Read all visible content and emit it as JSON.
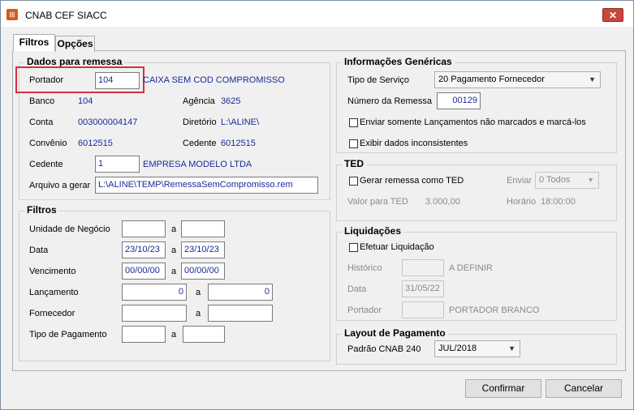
{
  "window": {
    "title": "CNAB CEF SIACC",
    "app_icon_glyph": "⊞",
    "close_glyph": "✕"
  },
  "tabs": [
    {
      "label": "Filtros",
      "active": true
    },
    {
      "label": "Opções",
      "active": false
    }
  ],
  "dados": {
    "legend": "Dados para remessa",
    "portador": {
      "label": "Portador",
      "value": "104",
      "desc": "CAIXA SEM COD COMPROMISSO"
    },
    "banco": {
      "label": "Banco",
      "value": "104"
    },
    "agencia": {
      "label": "Agência",
      "value": "3625"
    },
    "conta": {
      "label": "Conta",
      "value": "003000004147"
    },
    "diretorio": {
      "label": "Diretório",
      "value": "L:\\ALINE\\"
    },
    "convenio": {
      "label": "Convênio",
      "value": "6012515"
    },
    "cedente_code": {
      "label": "Cedente",
      "value": "6012515"
    },
    "cedente": {
      "label": "Cedente",
      "value": "1",
      "desc": "EMPRESA MODELO LTDA"
    },
    "arquivo": {
      "label": "Arquivo a gerar",
      "value": "L:\\ALINE\\TEMP\\RemessaSemCompromisso.rem"
    }
  },
  "filtros": {
    "legend": "Filtros",
    "sep": "a",
    "unidade": {
      "label": "Unidade de Negócio",
      "from": "",
      "to": ""
    },
    "data": {
      "label": "Data",
      "from": "23/10/23",
      "to": "23/10/23"
    },
    "vencimento": {
      "label": "Vencimento",
      "from": "00/00/00",
      "to": "00/00/00"
    },
    "lancamento": {
      "label": "Lançamento",
      "from": "0",
      "to": "0"
    },
    "fornecedor": {
      "label": "Fornecedor",
      "from": "",
      "to": ""
    },
    "tipo_pagamento": {
      "label": "Tipo de Pagamento",
      "from": "",
      "to": ""
    }
  },
  "info": {
    "legend": "Informações Genéricas",
    "tipo_servico": {
      "label": "Tipo de Serviço",
      "value": "20 Pagamento Fornecedor"
    },
    "numero_remessa": {
      "label": "Número da Remessa",
      "value": "00129"
    },
    "enviar_somente": {
      "label": "Enviar somente Lançamentos não marcados e marcá-los",
      "checked": false
    },
    "exibir_inconsistentes": {
      "label": "Exibir dados inconsistentes",
      "checked": false
    }
  },
  "ted": {
    "legend": "TED",
    "gerar": {
      "label": "Gerar remessa como TED",
      "checked": false
    },
    "enviar": {
      "label": "Enviar",
      "value": "0 Todos"
    },
    "valor": {
      "label": "Valor para TED",
      "value": "3.000,00"
    },
    "horario": {
      "label": "Horário",
      "value": "18:00:00"
    }
  },
  "liquidacoes": {
    "legend": "Liquidações",
    "efetuar": {
      "label": "Efetuar Liquidação",
      "checked": false
    },
    "historico": {
      "label": "Histórico",
      "value": "",
      "desc": "A DEFINIR"
    },
    "data": {
      "label": "Data",
      "value": "31/05/22"
    },
    "portador": {
      "label": "Portador",
      "value": "",
      "desc": "PORTADOR BRANCO"
    }
  },
  "layout": {
    "legend": "Layout de Pagamento",
    "padrao": {
      "label": "Padrão CNAB 240",
      "value": "JUL/2018"
    }
  },
  "buttons": {
    "confirmar": "Confirmar",
    "cancelar": "Cancelar"
  },
  "colors": {
    "value_text": "#1a2a99",
    "highlight_border": "#d6303a",
    "close_button": "#c9463d"
  }
}
